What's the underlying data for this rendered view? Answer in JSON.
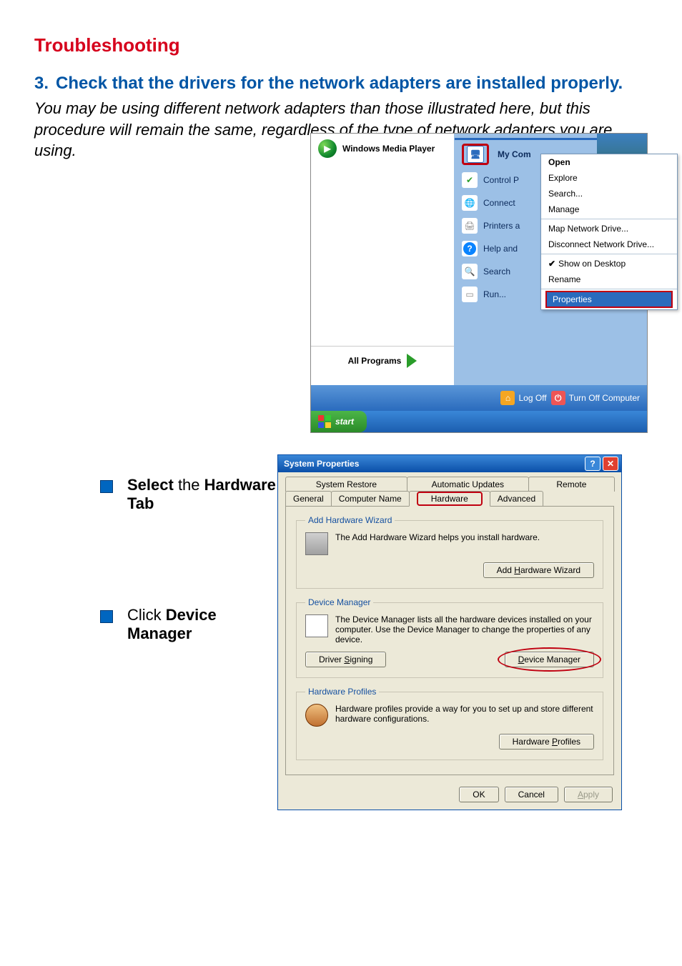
{
  "doc": {
    "page_title": "Troubleshooting",
    "step_number": "3.",
    "step_title": "Check that the drivers for the network adapters are installed properly.",
    "intro": "You may be using different network adapters than those illustrated here, but this procedure will remain the same, regardless of the type of network adapters you are using.",
    "bullet1_pre": "Select",
    "bullet1_post": " the ",
    "bullet1_b1": "Hardware Tab",
    "bullet2_pre": "Click ",
    "bullet2_b1": "Device Manager"
  },
  "startmenu": {
    "wmp": "Windows Media Player",
    "all_programs": "All Programs",
    "mycomputer": "My Com",
    "control_panel": "Control P",
    "connect": "Connect",
    "printers": "Printers a",
    "help": "Help and",
    "search": "Search",
    "run": "Run...",
    "context": {
      "open": "Open",
      "explore": "Explore",
      "search": "Search...",
      "manage": "Manage",
      "map": "Map Network Drive...",
      "disconnect": "Disconnect Network Drive...",
      "show": "Show on Desktop",
      "rename": "Rename",
      "properties": "Properties"
    },
    "logoff": "Log Off",
    "turnoff": "Turn Off Computer",
    "start": "start"
  },
  "sysprops": {
    "title": "System Properties",
    "tabs_top": {
      "sr": "System Restore",
      "au": "Automatic Updates",
      "rm": "Remote"
    },
    "tabs_bot": {
      "gen": "General",
      "cn": "Computer Name",
      "hw": "Hardware",
      "adv": "Advanced"
    },
    "hw_wizard": {
      "legend": "Add Hardware Wizard",
      "text": "The Add Hardware Wizard helps you install hardware.",
      "btn": "Add Hardware Wizard"
    },
    "dev_mgr": {
      "legend": "Device Manager",
      "text": "The Device Manager lists all the hardware devices installed on your computer. Use the Device Manager to change the properties of any device.",
      "btn_sign": "Driver Signing",
      "btn_dm": "Device Manager"
    },
    "hw_prof": {
      "legend": "Hardware Profiles",
      "text": "Hardware profiles provide a way for you to set up and store different hardware configurations.",
      "btn": "Hardware Profiles"
    },
    "ok": "OK",
    "cancel": "Cancel",
    "apply": "Apply"
  }
}
